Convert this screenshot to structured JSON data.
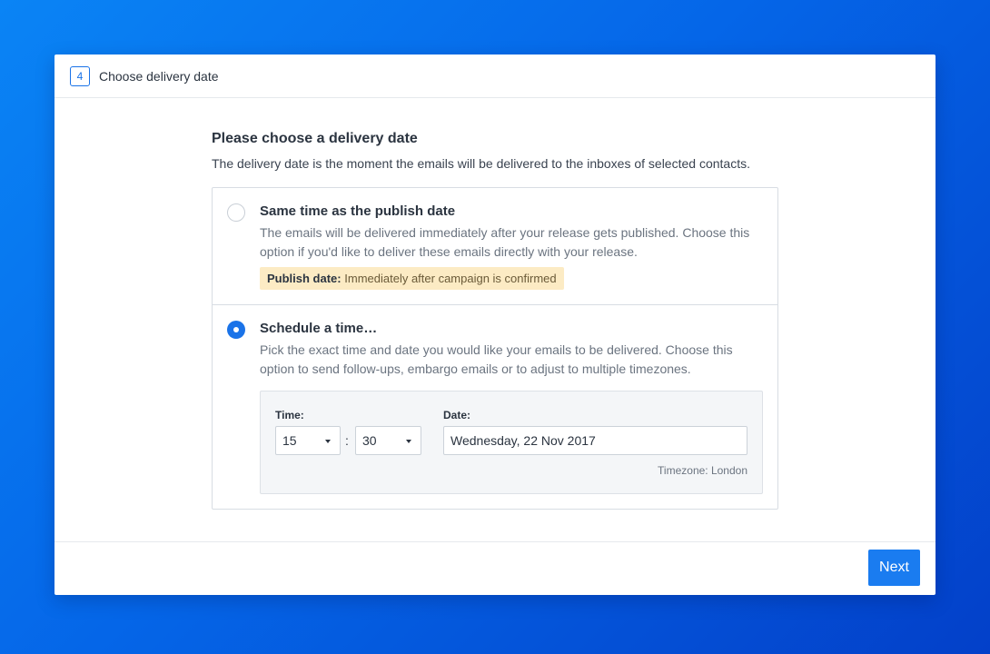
{
  "step": {
    "number": "4",
    "title": "Choose delivery date"
  },
  "section": {
    "title": "Please choose a delivery date",
    "description": "The delivery date is the moment the emails will be delivered to the inboxes of selected contacts."
  },
  "options": [
    {
      "title": "Same time as the publish date",
      "description": "The emails will be delivered immediately after your release gets published. Choose this option if you'd like to deliver these emails directly with your release.",
      "selected": false,
      "badge_label": "Publish date:",
      "badge_value": "Immediately after campaign is confirmed"
    },
    {
      "title": "Schedule a time…",
      "description": "Pick the exact time and date you would like your emails to be delivered. Choose this option to send follow-ups, embargo emails or to adjust to multiple timezones.",
      "selected": true
    }
  ],
  "schedule": {
    "time_label": "Time:",
    "hour": "15",
    "separator": ":",
    "minute": "30",
    "date_label": "Date:",
    "date_value": "Wednesday, 22 Nov 2017",
    "timezone": "Timezone: London"
  },
  "footer": {
    "next_label": "Next"
  },
  "colors": {
    "accent": "#1a7cf0",
    "badge_background": "#fcebc4"
  }
}
